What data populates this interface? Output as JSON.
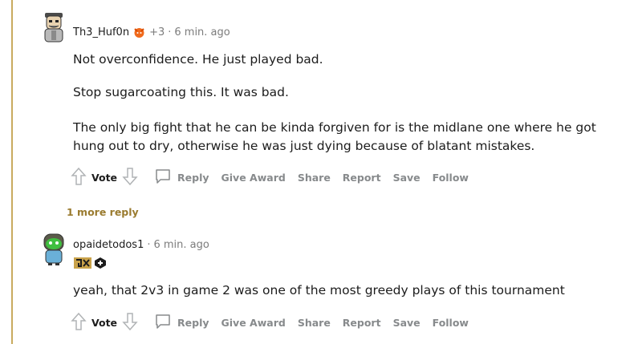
{
  "comment1": {
    "author": "Th3_Huf0n",
    "score": "+3",
    "separator": "·",
    "time": "6 min. ago",
    "paragraphs": [
      "Not overconfidence. He just played bad.",
      "Stop sugarcoating this. It was bad.",
      "The only big fight that he can be kinda forgiven for is the midlane one where he got",
      "hung out to dry, otherwise he was just dying because of blatant mistakes."
    ],
    "actions": {
      "vote": "Vote",
      "reply": "Reply",
      "give_award": "Give Award",
      "share": "Share",
      "report": "Report",
      "save": "Save",
      "follow": "Follow"
    }
  },
  "more_replies": "1 more reply",
  "comment2": {
    "author": "opaidetodos1",
    "separator": "·",
    "time": "6 min. ago",
    "text": "yeah, that 2v3 in game 2 was one of the most greedy plays of this tournament",
    "actions": {
      "vote": "Vote",
      "reply": "Reply",
      "give_award": "Give Award",
      "share": "Share",
      "report": "Report",
      "save": "Save",
      "follow": "Follow"
    }
  },
  "colors": {
    "thread_line": "#c9ab5f",
    "more_reply": "#9a7b2f",
    "action": "#878a8c"
  }
}
